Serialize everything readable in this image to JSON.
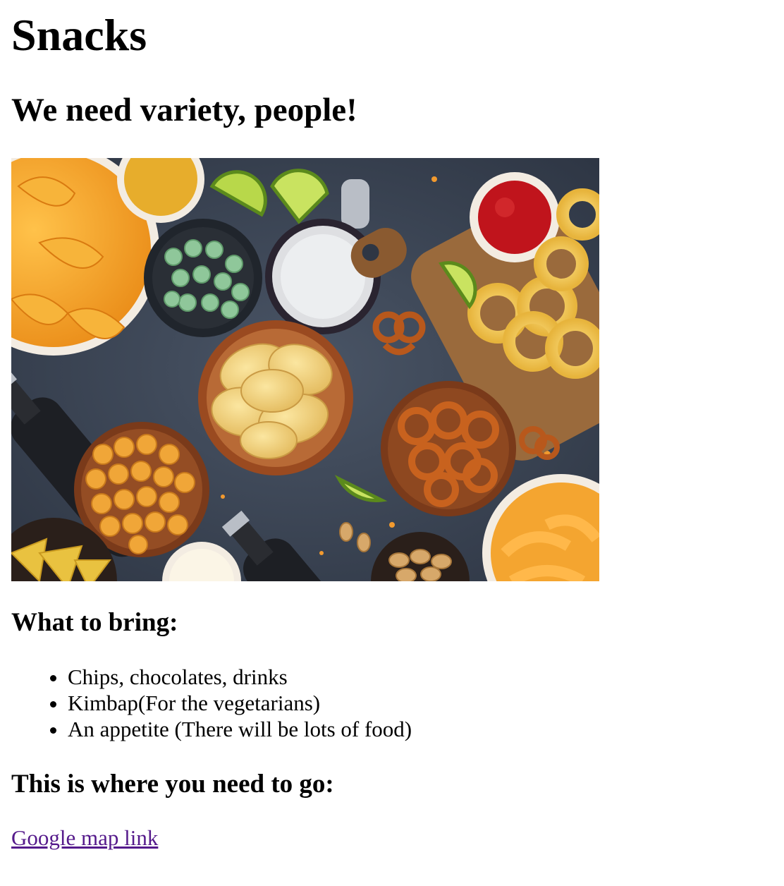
{
  "page": {
    "title": "Snacks",
    "subtitle": "We need variety, people!"
  },
  "hero_image": {
    "subject": "snack-spread-photo",
    "colors": {
      "table": "#3c4655",
      "chips": "#f2a634",
      "peas": "#8fc79a",
      "ketchup": "#c0141c",
      "board": "#9a6a3c",
      "pretzel": "#b8581c"
    }
  },
  "bring_section": {
    "heading": "What to bring:",
    "items": [
      "Chips, chocolates, drinks",
      "Kimbap(For the vegetarians)",
      "An appetite (There will be lots of food)"
    ]
  },
  "location_section": {
    "heading": "This is where you need to go:",
    "link_text": "Google map link"
  }
}
